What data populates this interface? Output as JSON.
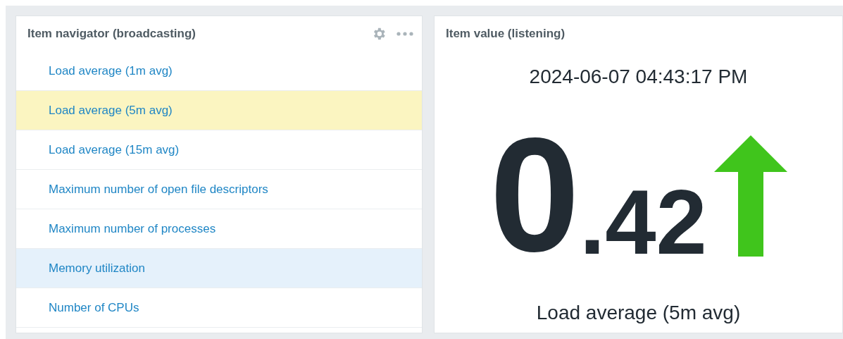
{
  "navigator": {
    "title": "Item navigator (broadcasting)",
    "items": [
      {
        "label": "Load average (1m avg)",
        "selected": false,
        "hovered": false
      },
      {
        "label": "Load average (5m avg)",
        "selected": true,
        "hovered": false
      },
      {
        "label": "Load average (15m avg)",
        "selected": false,
        "hovered": false
      },
      {
        "label": "Maximum number of open file descriptors",
        "selected": false,
        "hovered": false
      },
      {
        "label": "Maximum number of processes",
        "selected": false,
        "hovered": false
      },
      {
        "label": "Memory utilization",
        "selected": false,
        "hovered": true
      },
      {
        "label": "Number of CPUs",
        "selected": false,
        "hovered": false
      }
    ]
  },
  "item_value": {
    "title": "Item value (listening)",
    "timestamp": "2024-06-07 04:43:17 PM",
    "value_integer": "0",
    "value_fraction": ".42",
    "description": "Load average (5m avg)"
  }
}
